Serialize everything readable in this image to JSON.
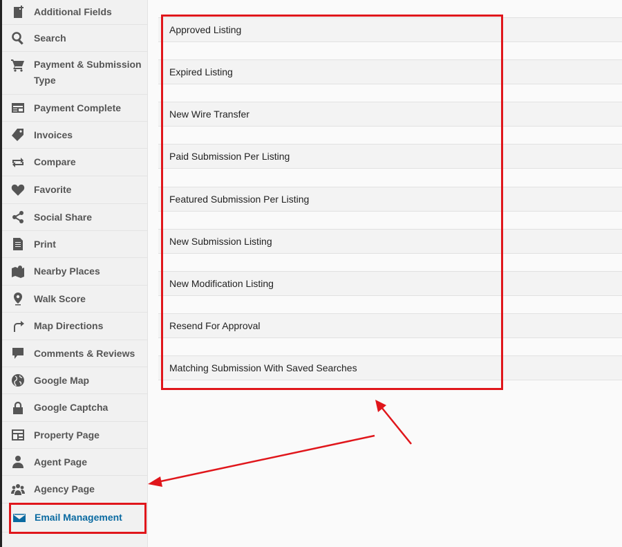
{
  "sidebar": {
    "items": [
      {
        "label": "Additional Fields",
        "icon": "add-document-icon"
      },
      {
        "label": "Search",
        "icon": "search-icon"
      },
      {
        "label": "Payment & Submission Type",
        "icon": "cart-icon"
      },
      {
        "label": "Payment Complete",
        "icon": "card-list-icon"
      },
      {
        "label": "Invoices",
        "icon": "tag-icon"
      },
      {
        "label": "Compare",
        "icon": "compare-icon"
      },
      {
        "label": "Favorite",
        "icon": "heart-icon"
      },
      {
        "label": "Social Share",
        "icon": "share-icon"
      },
      {
        "label": "Print",
        "icon": "document-icon"
      },
      {
        "label": "Nearby Places",
        "icon": "map-icon"
      },
      {
        "label": "Walk Score",
        "icon": "map-pin-icon"
      },
      {
        "label": "Map Directions",
        "icon": "redo-arrow-icon"
      },
      {
        "label": "Comments & Reviews",
        "icon": "comment-icon"
      },
      {
        "label": "Google Map",
        "icon": "globe-icon"
      },
      {
        "label": "Google Captcha",
        "icon": "lock-icon"
      },
      {
        "label": "Property Page",
        "icon": "layout-icon"
      },
      {
        "label": "Agent Page",
        "icon": "user-icon"
      },
      {
        "label": "Agency Page",
        "icon": "group-icon"
      },
      {
        "label": "Email Management",
        "icon": "envelope-icon"
      }
    ],
    "active": "Email Management"
  },
  "email_templates": [
    "Approved Listing",
    "Expired Listing",
    "New Wire Transfer",
    "Paid Submission Per Listing",
    "Featured Submission Per Listing",
    "New Submission Listing",
    "New Modification Listing",
    "Resend For Approval",
    "Matching Submission With Saved Searches"
  ],
  "colors": {
    "accent": "#0a6aa1",
    "annotation": "#e0161b",
    "icon": "#555555"
  }
}
